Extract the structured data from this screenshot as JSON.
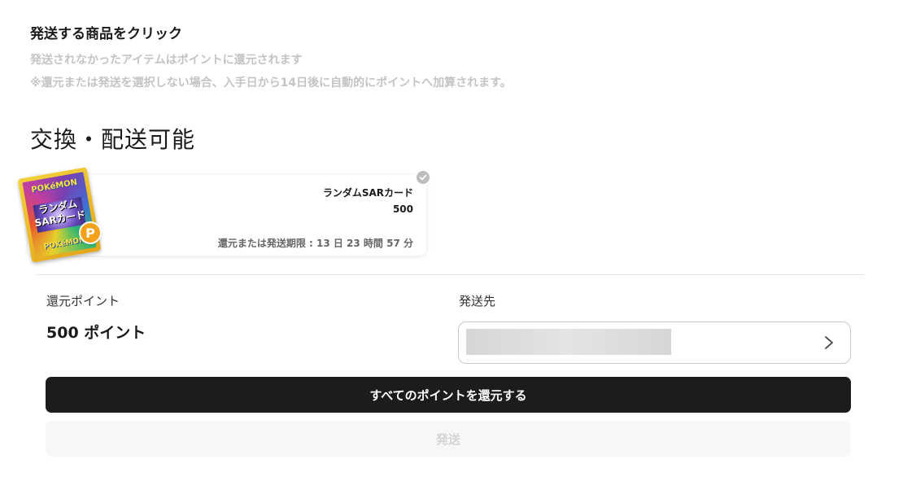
{
  "instructions": {
    "title": "発送する商品をクリック",
    "line1": "発送されなかったアイテムはポイントに還元されます",
    "line2": "※還元または発送を選択しない場合、入手日から14日後に自動的にポイントへ加算されます。"
  },
  "section": {
    "title": "交換・配送可能"
  },
  "item": {
    "name": "ランダムSARカード",
    "value": "500",
    "deadline": "還元または発送期限 : 13 日 23 時間 57 分",
    "selected": true,
    "card_art": {
      "top_text": "POKéMON",
      "mid_text_1": "ランダム",
      "mid_text_2": "SARカード",
      "bottom_text": "POKéMON"
    },
    "badge": "P",
    "icon": "check-icon"
  },
  "summary": {
    "return_label": "還元ポイント",
    "return_value": "500 ポイント",
    "destination_label": "発送先"
  },
  "buttons": {
    "return_all": "すべてのポイントを還元する",
    "ship": "発送"
  },
  "colors": {
    "primary_button": "#1c1c1c",
    "disabled_button": "#f7f7f7",
    "point_badge": "#f3a21a",
    "muted_text": "#c4c4c4"
  }
}
